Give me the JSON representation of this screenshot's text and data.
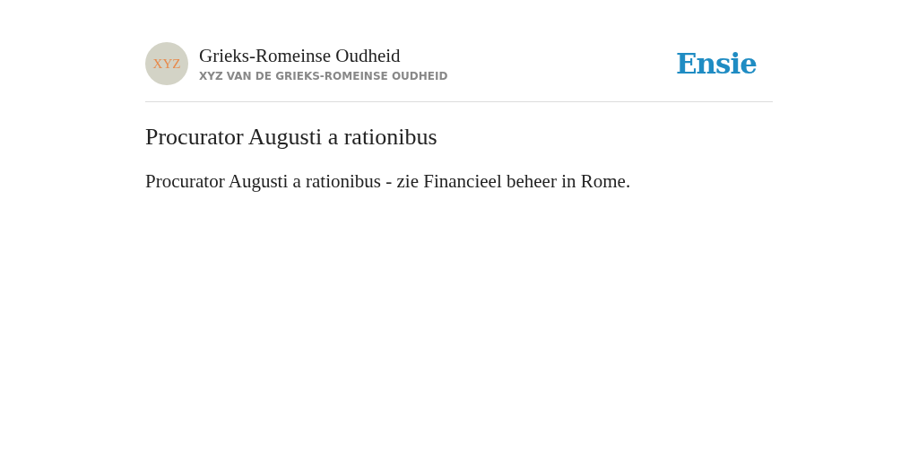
{
  "header": {
    "avatar": "XYZ",
    "title": "Grieks-Romeinse Oudheid",
    "subtitle": "XYZ VAN DE GRIEKS-ROMEINSE OUDHEID",
    "logo": "Ensie"
  },
  "article": {
    "heading": "Procurator Augusti a rationibus",
    "body": "Procurator Augusti a rationibus - zie Financieel beheer in Rome."
  }
}
